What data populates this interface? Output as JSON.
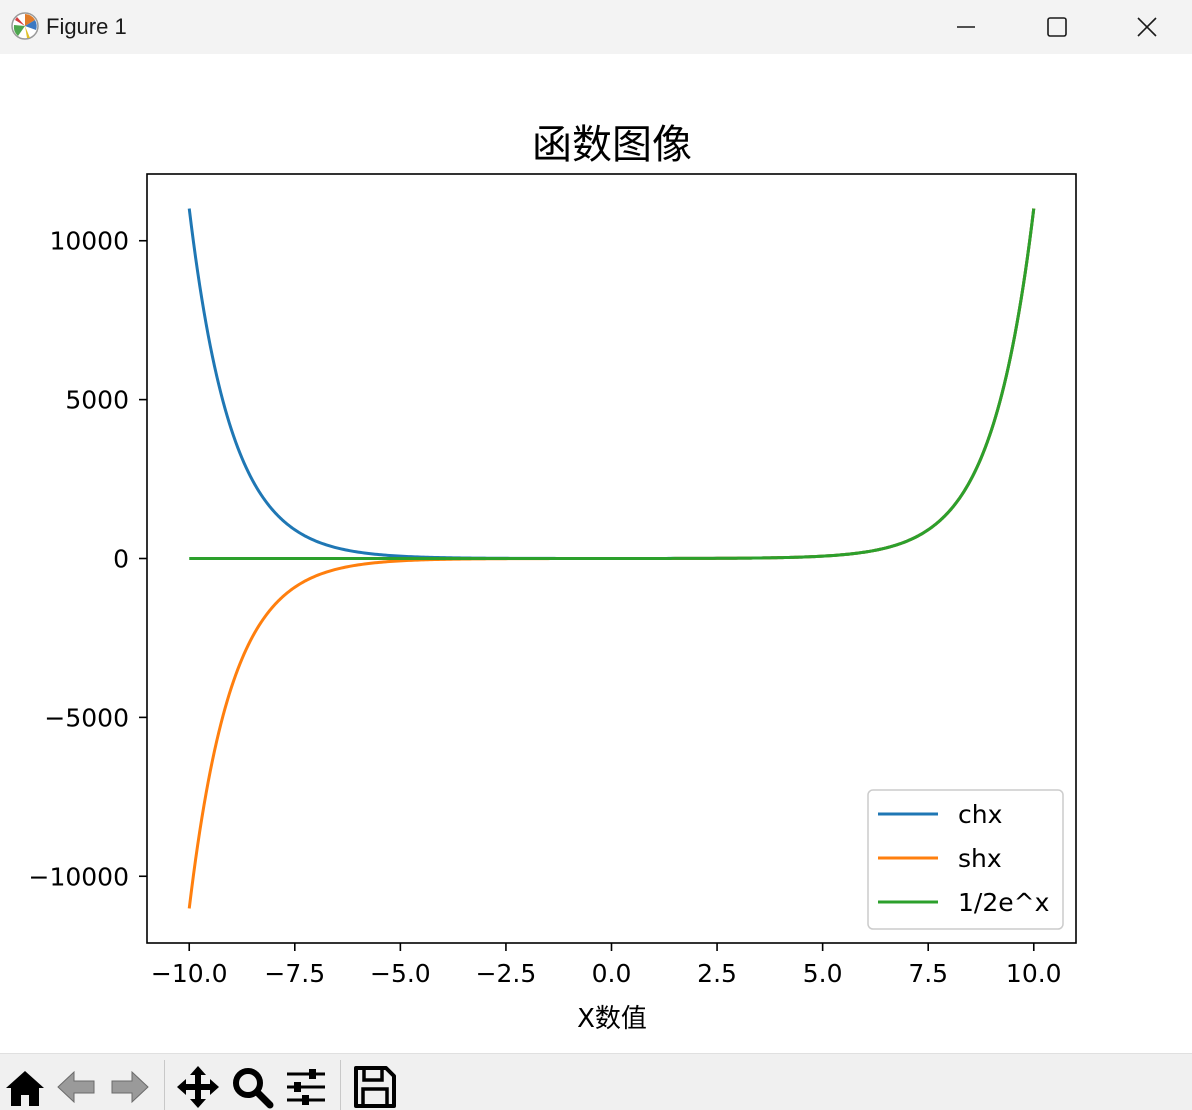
{
  "window": {
    "title": "Figure 1",
    "app_icon": "matplotlib-icon",
    "controls": [
      "minimize-icon",
      "maximize-icon",
      "close-icon"
    ]
  },
  "toolbar": {
    "tools": [
      "home-icon",
      "back-arrow-icon",
      "forward-arrow-icon",
      "pan-move-icon",
      "zoom-magnifier-icon",
      "configure-subplots-icon",
      "save-disk-icon"
    ]
  },
  "chart_data": {
    "type": "line",
    "title": "函数图像",
    "xlabel": "X数值",
    "ylabel": "",
    "xlim": [
      -11.0,
      11.0
    ],
    "ylim": [
      -12100,
      12100
    ],
    "x_ticks": [
      -10.0,
      -7.5,
      -5.0,
      -2.5,
      0.0,
      2.5,
      5.0,
      7.5,
      10.0
    ],
    "x_tick_labels": [
      "−10.0",
      "−7.5",
      "−5.0",
      "−2.5",
      "0.0",
      "2.5",
      "5.0",
      "7.5",
      "10.0"
    ],
    "y_ticks": [
      10000,
      5000,
      0,
      -5000,
      -10000
    ],
    "y_tick_labels": [
      "10000",
      "5000",
      "0",
      "−5000",
      "−10000"
    ],
    "x_range": [
      -10,
      10
    ],
    "grid": false,
    "legend_position": "lower right",
    "series": [
      {
        "name": "chx",
        "color": "#1f77b4",
        "function": "cosh"
      },
      {
        "name": "shx",
        "color": "#ff7f0e",
        "function": "sinh"
      },
      {
        "name": "1/2e^x",
        "color": "#2ca02c",
        "function": "half_exp"
      }
    ]
  }
}
